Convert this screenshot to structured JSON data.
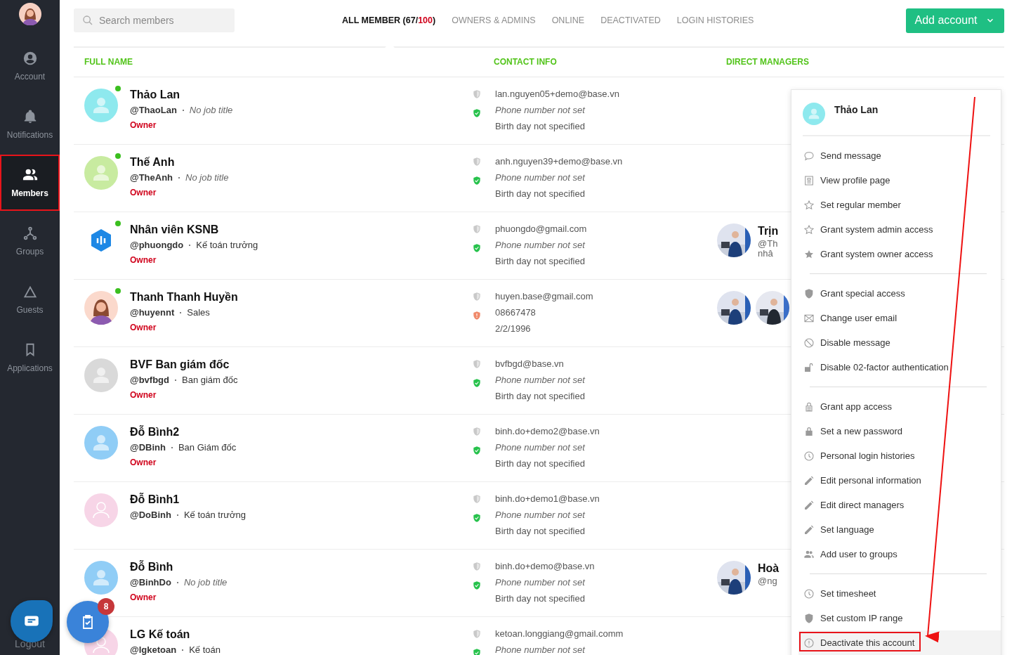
{
  "sidebar": {
    "items": [
      {
        "label": "Account",
        "kind": "account",
        "selected": false,
        "annotated": false
      },
      {
        "label": "Notifications",
        "kind": "bell",
        "selected": false,
        "annotated": false
      },
      {
        "label": "Members",
        "kind": "members",
        "selected": true,
        "annotated": true
      },
      {
        "label": "Groups",
        "kind": "groups",
        "selected": false,
        "annotated": false
      },
      {
        "label": "Guests",
        "kind": "guests",
        "selected": false,
        "annotated": false
      },
      {
        "label": "Applications",
        "kind": "apps",
        "selected": false,
        "annotated": false
      }
    ],
    "logout": "Logout"
  },
  "search": {
    "placeholder": "Search members"
  },
  "tabs": [
    {
      "label": "ALL MEMBER (67/",
      "limit": "100",
      "suffix": ")",
      "selected": true
    },
    {
      "label": "OWNERS & ADMINS",
      "selected": false
    },
    {
      "label": "ONLINE",
      "selected": false
    },
    {
      "label": "DEACTIVATED",
      "selected": false
    },
    {
      "label": "LOGIN HISTORIES",
      "selected": false
    }
  ],
  "add_button": "Add account",
  "table": {
    "columns": [
      "FULL NAME",
      "CONTACT INFO",
      "DIRECT MANAGERS"
    ],
    "rows": [
      {
        "kind": "placeholder",
        "color": "#8ee9ee",
        "online": true,
        "name": "Thảo Lan",
        "handle": "@ThaoLan",
        "job": "No job title",
        "job_set": false,
        "role": "Owner",
        "warning": false,
        "email": "lan.nguyen05+demo@base.vn",
        "phone": "Phone number not set",
        "phone_set": false,
        "birthday": "Birth day not specified"
      },
      {
        "kind": "placeholder",
        "color": "#c8eba0",
        "online": true,
        "name": "Thế Anh",
        "handle": "@TheAnh",
        "job": "No job title",
        "job_set": false,
        "role": "Owner",
        "warning": false,
        "email": "anh.nguyen39+demo@base.vn",
        "phone": "Phone number not set",
        "phone_set": false,
        "birthday": "Birth day not specified"
      },
      {
        "kind": "logo",
        "online": true,
        "name": "Nhân viên KSNB",
        "handle": "@phuongdo",
        "job": "Kế toán trưởng",
        "job_set": true,
        "role": "Owner",
        "warning": false,
        "email": "phuongdo@gmail.com",
        "phone": "Phone number not set",
        "phone_set": false,
        "birthday": "Birth day not specified",
        "manager_name": "Trịn",
        "manager_handle": "@Th",
        "manager_job": "nhâ"
      },
      {
        "kind": "illustration",
        "online": true,
        "name": "Thanh Thanh Huyền",
        "handle": "@huyennt",
        "job": "Sales",
        "job_set": true,
        "role": "Owner",
        "warning": true,
        "email": "huyen.base@gmail.com",
        "phone": "08667478",
        "phone_set": true,
        "birthday": "2/2/1996"
      },
      {
        "kind": "placeholder",
        "color": "#d9d9d9",
        "online": false,
        "name": "BVF Ban giám đốc",
        "handle": "@bvfbgd",
        "job": "Ban giám đốc",
        "job_set": true,
        "role": "Owner",
        "warning": false,
        "email": "bvfbgd@base.vn",
        "phone": "Phone number not set",
        "phone_set": false,
        "birthday": "Birth day not specified"
      },
      {
        "kind": "placeholder",
        "color": "#90cdf6",
        "online": false,
        "name": "Đỗ Bình2",
        "handle": "@DBinh",
        "job": "Ban Giám đốc",
        "job_set": true,
        "role": "Owner",
        "warning": false,
        "email": "binh.do+demo2@base.vn",
        "phone": "Phone number not set",
        "phone_set": false,
        "birthday": "Birth day not specified"
      },
      {
        "kind": "outline",
        "color": "#f7d5e7",
        "online": false,
        "name": "Đỗ Bình1",
        "handle": "@DoBinh",
        "job": "Kế toán trưởng",
        "job_set": true,
        "warning": false,
        "email": "binh.do+demo1@base.vn",
        "phone": "Phone number not set",
        "phone_set": false,
        "birthday": "Birth day not specified"
      },
      {
        "kind": "placeholder",
        "color": "#90cdf6",
        "online": false,
        "name": "Đỗ Bình",
        "handle": "@BinhDo",
        "job": "No job title",
        "job_set": false,
        "role": "Owner",
        "warning": false,
        "email": "binh.do+demo@base.vn",
        "phone": "Phone number not set",
        "phone_set": false,
        "birthday": "Birth day not specified",
        "manager_name": "Hoà",
        "manager_handle": "@ng"
      },
      {
        "kind": "outline",
        "color": "#f7d5e7",
        "online": false,
        "name": "LG Kế toán",
        "handle": "@lgketoan",
        "job": "Kế toán",
        "job_set": true,
        "warning": false,
        "email": "ketoan.longgiang@gmail.comm",
        "phone": "Phone number not set",
        "phone_set": false
      }
    ]
  },
  "menu": {
    "name": "Thảo Lan",
    "groups": [
      [
        {
          "label": "Send message",
          "kind": "chat",
          "highlighted": false
        },
        {
          "label": "View profile page",
          "kind": "profile",
          "highlighted": false
        },
        {
          "label": "Set regular member",
          "kind": "star-outline",
          "highlighted": false
        },
        {
          "label": "Grant system admin access",
          "kind": "star-outline",
          "highlighted": false
        },
        {
          "label": "Grant system owner access",
          "kind": "star",
          "highlighted": false
        }
      ],
      [
        {
          "label": "Grant special access",
          "kind": "shield-star",
          "highlighted": false
        },
        {
          "label": "Change user email",
          "kind": "mail",
          "highlighted": false
        },
        {
          "label": "Disable message",
          "kind": "block",
          "highlighted": false
        },
        {
          "label": "Disable 02-factor authentication",
          "kind": "unlock",
          "highlighted": false
        }
      ],
      [
        {
          "label": "Grant app access",
          "kind": "lock-outline",
          "highlighted": false
        },
        {
          "label": "Set a new password",
          "kind": "lock",
          "highlighted": false
        },
        {
          "label": "Personal login histories",
          "kind": "clock",
          "highlighted": false
        },
        {
          "label": "Edit personal information",
          "kind": "pencil",
          "highlighted": false
        },
        {
          "label": "Edit direct managers",
          "kind": "pencil",
          "highlighted": false
        },
        {
          "label": "Set language",
          "kind": "pencil",
          "highlighted": false
        },
        {
          "label": "Add user to groups",
          "kind": "users",
          "highlighted": false
        }
      ],
      [
        {
          "label": "Set timesheet",
          "kind": "clock",
          "highlighted": false
        },
        {
          "label": "Set custom IP range",
          "kind": "shield",
          "highlighted": false
        },
        {
          "label": "Deactivate this account",
          "kind": "alert",
          "highlighted": true
        }
      ]
    ]
  },
  "task_badge": "8"
}
